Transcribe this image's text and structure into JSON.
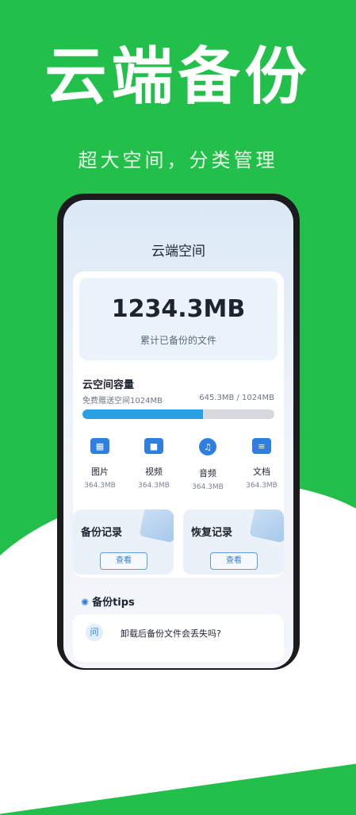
{
  "hero": {
    "title": "云端备份",
    "subtitle": "超大空间，分类管理"
  },
  "screen": {
    "title": "云端空间",
    "total": {
      "value": "1234.3MB",
      "label": "累计已备份的文件"
    },
    "capacity": {
      "title": "云空间容量",
      "gift_text": "免费赠送空间1024MB",
      "usage_text": "645.3MB / 1024MB",
      "used_fraction": 0.63
    },
    "categories": [
      {
        "label": "图片",
        "size": "364.3MB",
        "icon": "image-icon",
        "color": "#2f7fe0",
        "glyph": "▦"
      },
      {
        "label": "视频",
        "size": "364.3MB",
        "icon": "video-camera-icon",
        "color": "#2f7fe0",
        "glyph": "■"
      },
      {
        "label": "音频",
        "size": "364.3MB",
        "icon": "music-icon",
        "color": "#2f7fe0",
        "glyph": "♫"
      },
      {
        "label": "文档",
        "size": "364.3MB",
        "icon": "document-icon",
        "color": "#2f7fe0",
        "glyph": "≡"
      }
    ],
    "backup_card": {
      "title": "备份记录",
      "button": "查看"
    },
    "restore_card": {
      "title": "恢复记录",
      "button": "查看"
    },
    "tips": {
      "title": "备份tips",
      "first_question": "卸载后备份文件会丢失吗?",
      "first_icon_text": "问"
    }
  }
}
